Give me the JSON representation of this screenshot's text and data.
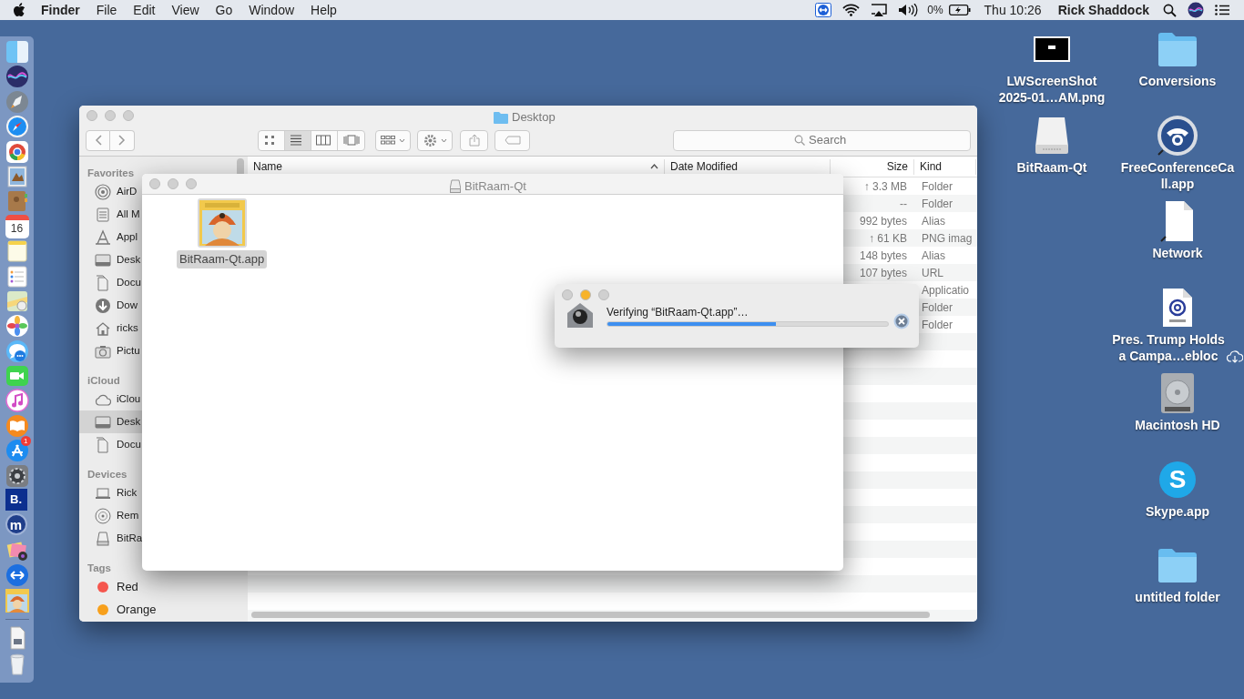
{
  "menu_bar": {
    "app_name": "Finder",
    "menus": [
      "File",
      "Edit",
      "View",
      "Go",
      "Window",
      "Help"
    ],
    "battery": "0%",
    "clock": "Thu 10:26",
    "user": "Rick Shaddock"
  },
  "dock": {
    "calendar_day": "16",
    "app_badge": "1",
    "tile_letter": "B.",
    "round_letter": "m"
  },
  "finder": {
    "title": "Desktop",
    "view_buttons": [
      {
        "kind": "icons",
        "selected": false
      },
      {
        "kind": "list",
        "selected": true
      },
      {
        "kind": "columns",
        "selected": false
      },
      {
        "kind": "cover_flow",
        "selected": false
      }
    ],
    "search": {
      "placeholder": "Search"
    },
    "sidebar": [
      {
        "heading": "Favorites",
        "items": [
          {
            "label": "AirD",
            "kind": "airdrop",
            "selected": false
          },
          {
            "label": "All M",
            "kind": "all_files",
            "selected": false
          },
          {
            "label": "Appl",
            "kind": "applications",
            "selected": false
          },
          {
            "label": "Desk",
            "kind": "desktop",
            "selected": false
          },
          {
            "label": "Docu",
            "kind": "documents",
            "selected": false
          },
          {
            "label": "Dow",
            "kind": "downloads",
            "selected": false
          },
          {
            "label": "ricks",
            "kind": "home",
            "selected": false
          },
          {
            "label": "Pictu",
            "kind": "pictures",
            "selected": false
          }
        ]
      },
      {
        "heading": "iCloud",
        "items": [
          {
            "label": "iClou",
            "kind": "cloud",
            "selected": false
          },
          {
            "label": "Desk",
            "kind": "desktop",
            "selected": true
          },
          {
            "label": "Docu",
            "kind": "documents",
            "selected": false
          }
        ]
      },
      {
        "heading": "Devices",
        "items": [
          {
            "label": "Rick",
            "kind": "laptop",
            "selected": false
          },
          {
            "label": "Rem",
            "kind": "disc",
            "selected": false
          },
          {
            "label": "BitRa",
            "kind": "drive",
            "selected": false
          }
        ]
      },
      {
        "heading": "Tags",
        "items": [
          {
            "label": "Red",
            "kind": "tag",
            "color": "#f5564e",
            "selected": false
          },
          {
            "label": "Orange",
            "kind": "tag",
            "color": "#f7a01c",
            "selected": false
          }
        ]
      }
    ],
    "columns": [
      {
        "label": "Name",
        "sorted": true
      },
      {
        "label": "Date Modified",
        "sorted": false
      },
      {
        "label": "Size",
        "sorted": false
      },
      {
        "label": "Kind",
        "sorted": false
      }
    ],
    "rows": [
      {
        "size": "↑ 3.3 MB",
        "file_kind": "Folder"
      },
      {
        "size": "--",
        "file_kind": "Folder"
      },
      {
        "size": "992 bytes",
        "file_kind": "Alias"
      },
      {
        "size": "↑ 61 KB",
        "file_kind": "PNG imag"
      },
      {
        "size": "148 bytes",
        "file_kind": "Alias"
      },
      {
        "size": "107 bytes",
        "file_kind": "URL"
      },
      {
        "file_kind": "Applicatio"
      },
      {
        "file_kind": "Folder"
      },
      {
        "file_kind": "Folder"
      }
    ]
  },
  "volume_window": {
    "title": "BitRaam-Qt",
    "items": [
      {
        "label": "BitRaam-Qt.app",
        "selected": true
      }
    ]
  },
  "verify_dialog": {
    "message": "Verifying “BitRaam-Qt.app”…",
    "level": 0.6
  },
  "desktop": {
    "columns": [
      [
        {
          "label_lines": [
            "LWScreenShot",
            "2025-01…AM.png"
          ],
          "kind": "screenshot"
        },
        {
          "label_lines": [
            "BitRaam-Qt"
          ],
          "kind": "drive"
        }
      ],
      [
        {
          "label_lines": [
            "Conversions"
          ],
          "kind": "folder"
        },
        {
          "label_lines": [
            "FreeConferenceCa",
            "ll.app"
          ],
          "kind": "phone_app"
        },
        {
          "label_lines": [
            "Network"
          ],
          "kind": "alias_doc"
        },
        {
          "label_lines": [
            "Pres. Trump Holds",
            "a Campa…ebloc"
          ],
          "kind": "webloc",
          "in_cloud": true
        },
        {
          "label_lines": [
            "Macintosh HD"
          ],
          "kind": "hard_disk"
        },
        {
          "label_lines": [
            "Skype.app"
          ],
          "kind": "skype",
          "icon_letter": "S"
        },
        {
          "label_lines": [
            "untitled folder"
          ],
          "kind": "folder"
        }
      ]
    ]
  }
}
